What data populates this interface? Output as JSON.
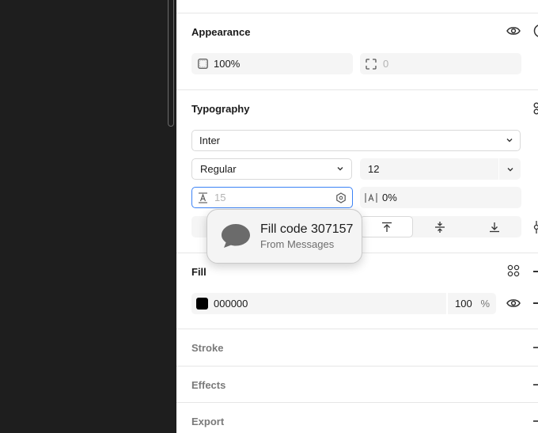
{
  "appearance": {
    "title": "Appearance",
    "opacity": "100%",
    "radius_placeholder": "0"
  },
  "typography": {
    "title": "Typography",
    "font_family": "Inter",
    "font_weight": "Regular",
    "font_size": "12",
    "line_height_placeholder": "15",
    "letter_spacing": "0%"
  },
  "fill": {
    "title": "Fill",
    "hex": "000000",
    "opacity": "100",
    "opacity_unit": "%",
    "swatch_color": "#000000"
  },
  "stroke": {
    "title": "Stroke"
  },
  "effects": {
    "title": "Effects"
  },
  "export": {
    "title": "Export"
  },
  "notification": {
    "title": "Fill code 307157",
    "subtitle": "From Messages"
  }
}
